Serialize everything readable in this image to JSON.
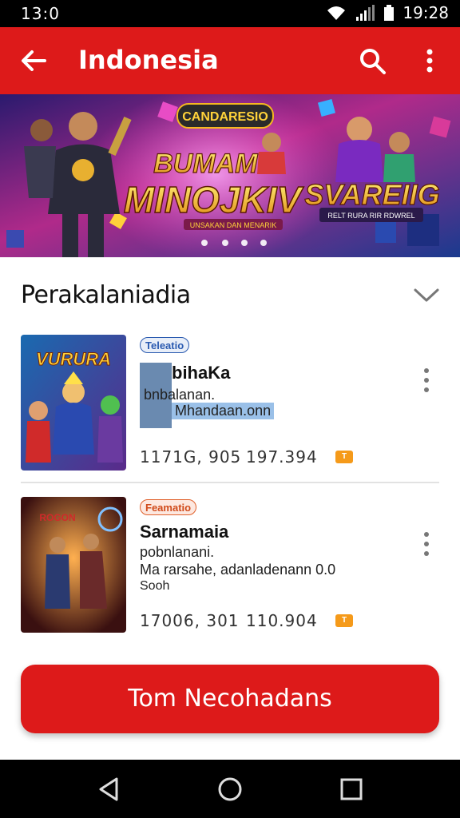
{
  "status_bar": {
    "time_left": "13:0",
    "time_right": "19:28"
  },
  "app_bar": {
    "title": "Indonesia"
  },
  "banner": {
    "badge_text": "CANDARESIO",
    "headline_line1": "BUMAMI",
    "headline_line2": "MINOJKIV",
    "subtitle": "UNSAKAN DAN MENARIK",
    "right_title": "SVAREIIG",
    "right_caption": "RELT RURA RIR RDWREL",
    "dots": 4
  },
  "section": {
    "label": "Perakalaniadia"
  },
  "cards": [
    {
      "tag": "Teleatio",
      "name": "bihaKa",
      "line1": "bnbalanan.",
      "line2": "Mhandaan.onn",
      "stat1": "1171G, 905",
      "stat2": "197.394",
      "thumb_text": "VURURA"
    },
    {
      "tag": "Feamatio",
      "name": "Sarnamaia",
      "line1": "pobnlanani.",
      "line2": "Ma rarsahe, adanladenann 0.0",
      "line3": "Sooh",
      "stat1": "17006, 301",
      "stat2": "110.904",
      "thumb_text": "ROGON"
    }
  ],
  "cta": {
    "label": "Tom Necohadans"
  },
  "colors": {
    "primary": "#dd1a1a",
    "badge": "#f59a1a"
  }
}
